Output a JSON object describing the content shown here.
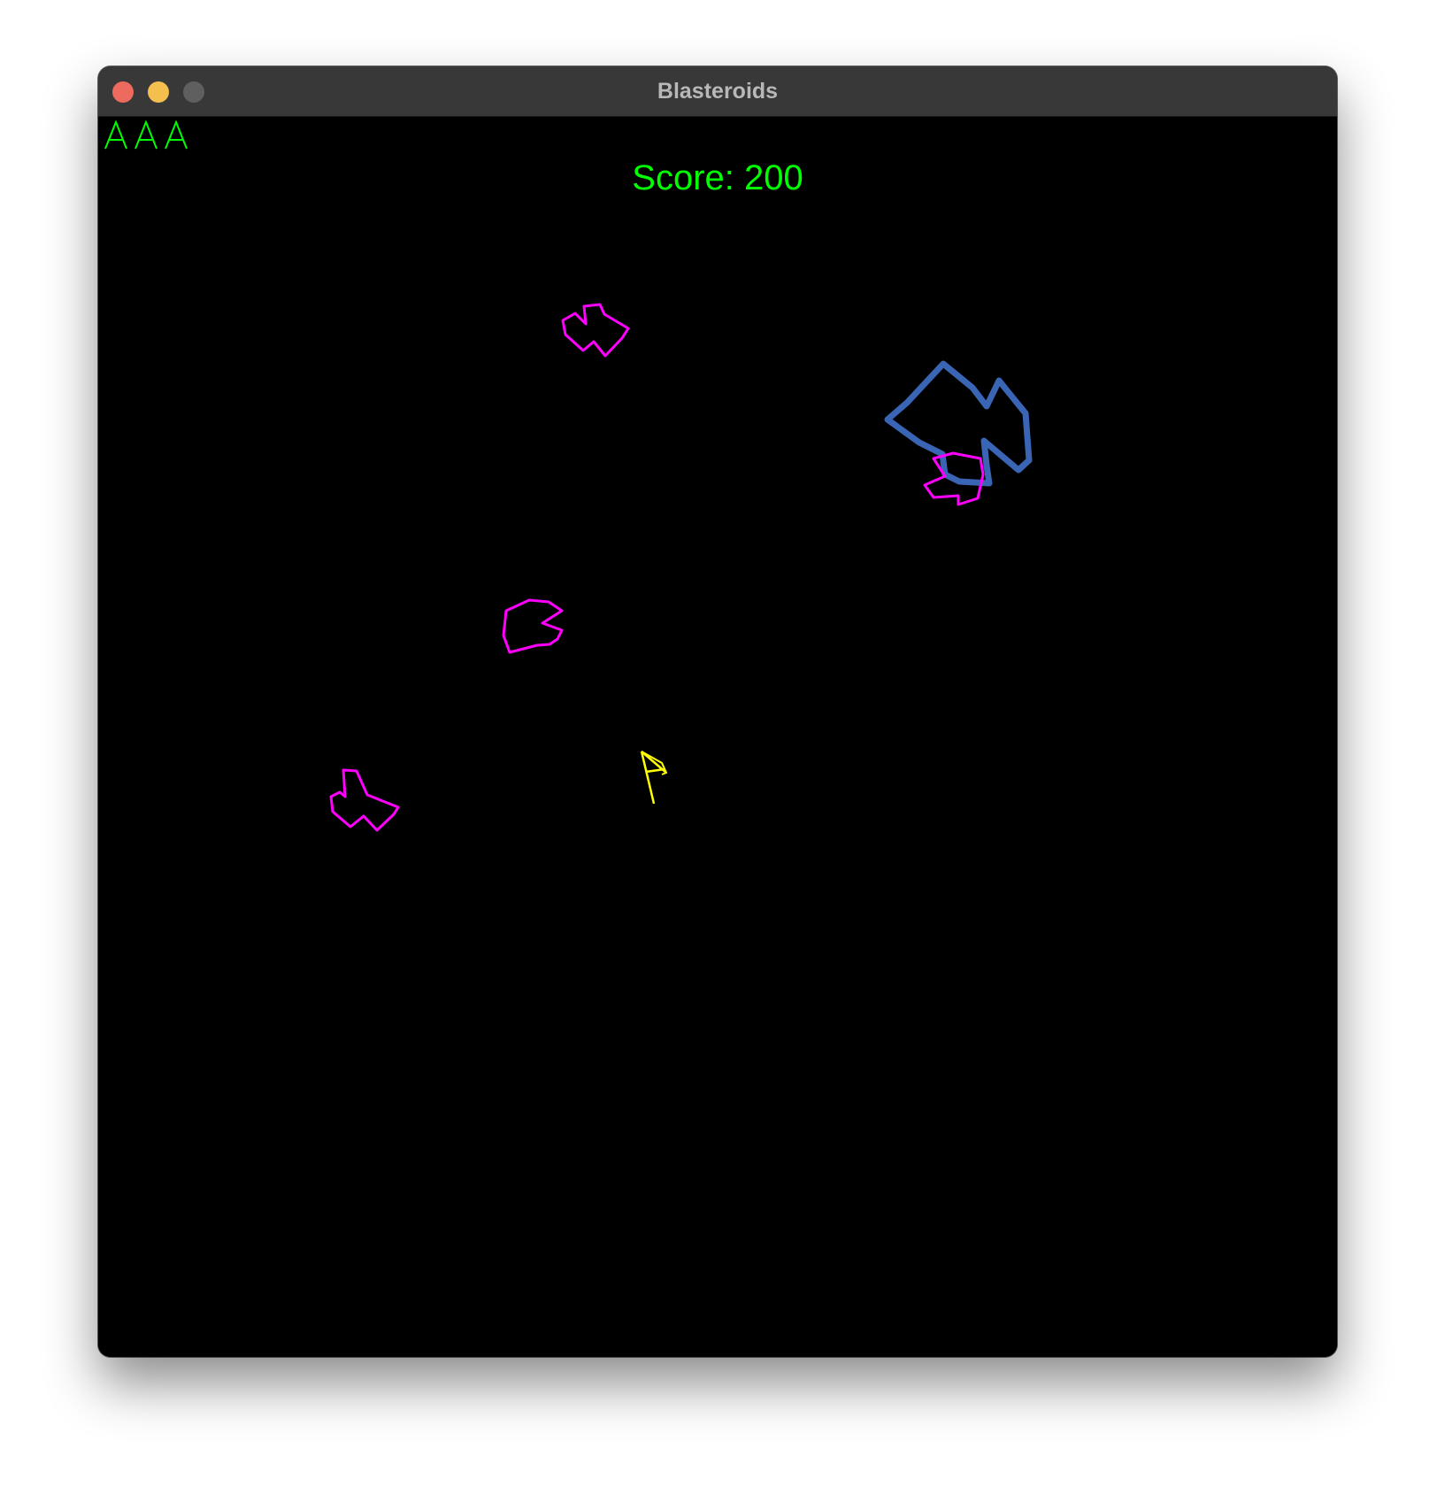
{
  "window": {
    "title": "Blasteroids",
    "traffic_lights": [
      {
        "name": "close",
        "color": "#ec6a5e"
      },
      {
        "name": "minimize",
        "color": "#f4bf4f"
      },
      {
        "name": "zoom",
        "color": "#5f5f5f"
      }
    ]
  },
  "hud": {
    "score_text": "Score: 200",
    "score_color": "#00ff00",
    "lives_remaining": 3,
    "lives_color": "#00ff00"
  },
  "ship": {
    "color": "#ffff00",
    "icon": "ship-icon"
  },
  "asteroids": [
    {
      "size": "large",
      "color": "#3a64b4"
    },
    {
      "size": "small",
      "color": "#ff00ff"
    },
    {
      "size": "small",
      "color": "#ff00ff"
    },
    {
      "size": "small",
      "color": "#ff00ff"
    },
    {
      "size": "small",
      "color": "#ff00ff"
    }
  ]
}
